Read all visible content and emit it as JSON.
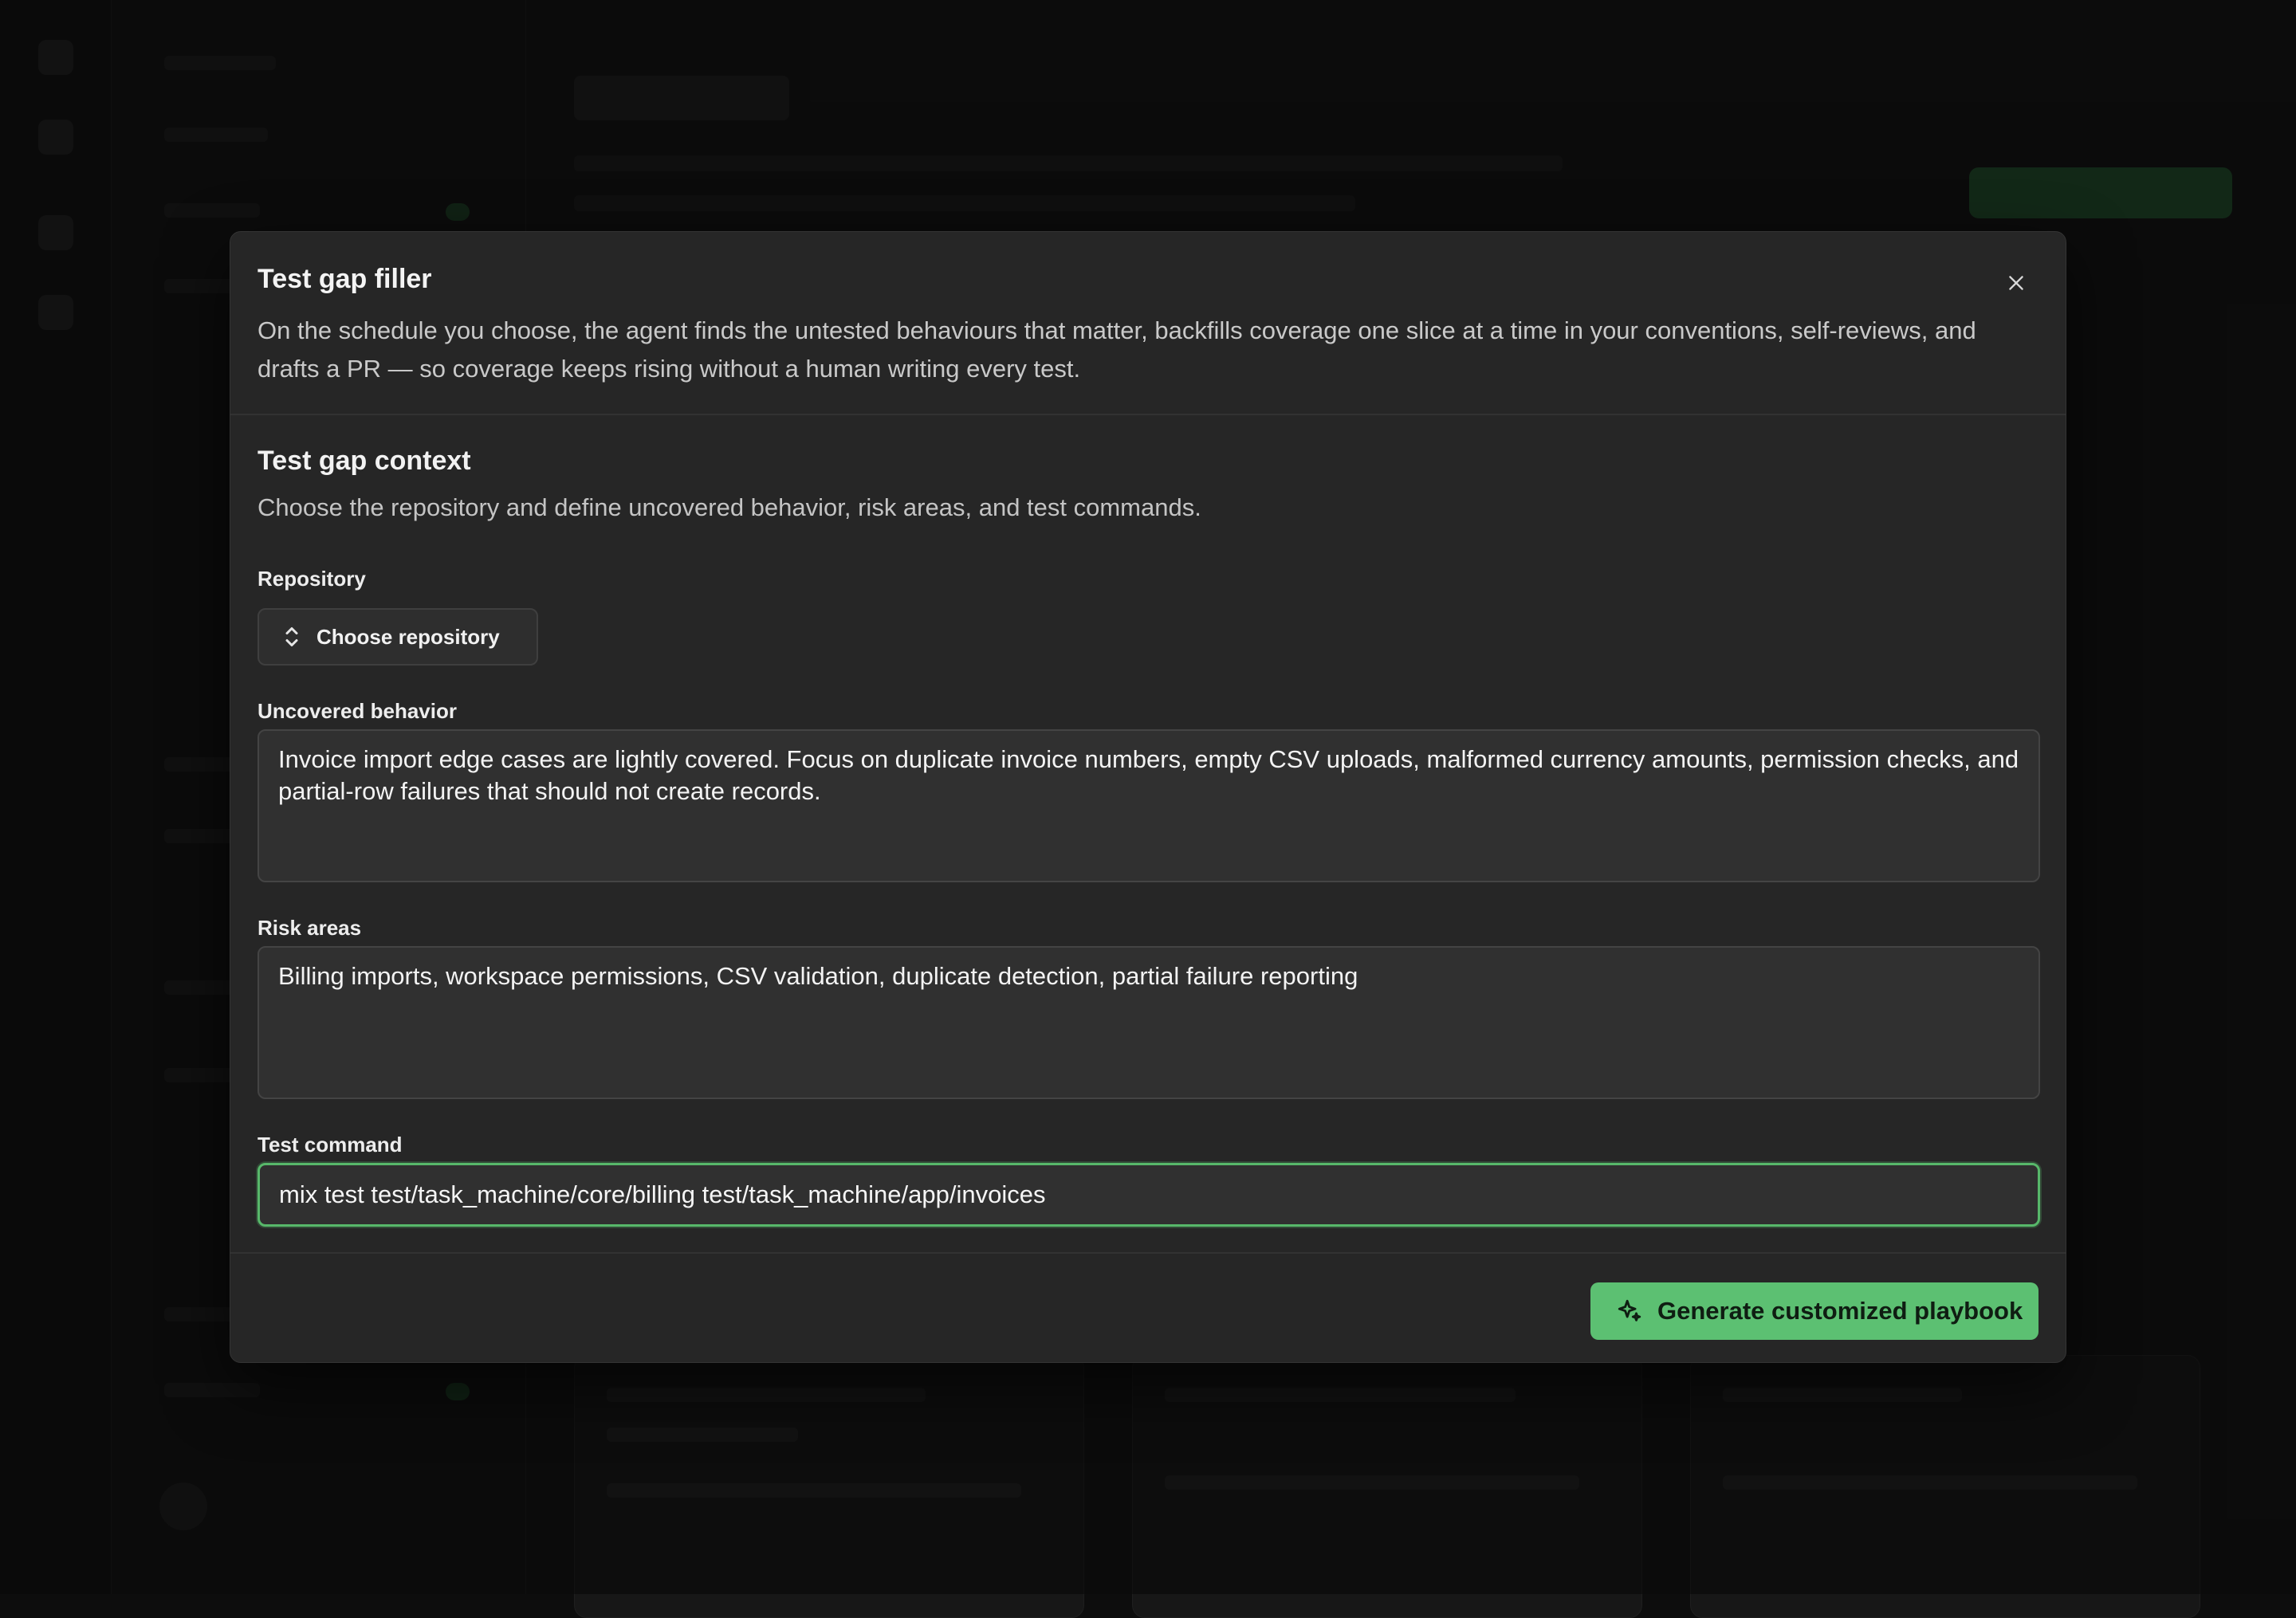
{
  "modal": {
    "title": "Test gap filler",
    "description": "On the schedule you choose, the agent finds the untested behaviours that matter, backfills coverage one slice at a time in your conventions, self-reviews, and drafts a PR — so coverage keeps rising without a human writing every test.",
    "close_icon": "close-icon"
  },
  "section": {
    "title": "Test gap context",
    "description": "Choose the repository and define uncovered behavior, risk areas, and test commands."
  },
  "repository": {
    "label": "Repository",
    "button_label": "Choose repository",
    "icon": "chevron-up-down-icon"
  },
  "uncovered_behavior": {
    "label": "Uncovered behavior",
    "value": "Invoice import edge cases are lightly covered. Focus on duplicate invoice numbers, empty CSV uploads, malformed currency amounts, permission checks, and partial-row failures that should not create records."
  },
  "risk_areas": {
    "label": "Risk areas",
    "value": "Billing imports, workspace permissions, CSV validation, duplicate detection, partial failure reporting"
  },
  "test_command": {
    "label": "Test command",
    "value": "mix test test/task_machine/core/billing test/task_machine/app/invoices"
  },
  "footer": {
    "generate_label": "Generate customized playbook",
    "generate_icon": "sparkle-icon"
  },
  "colors": {
    "accent": "#5cc072",
    "focus_border": "#57b86a",
    "modal_bg": "#262626",
    "backdrop": "#0d0d0d"
  }
}
